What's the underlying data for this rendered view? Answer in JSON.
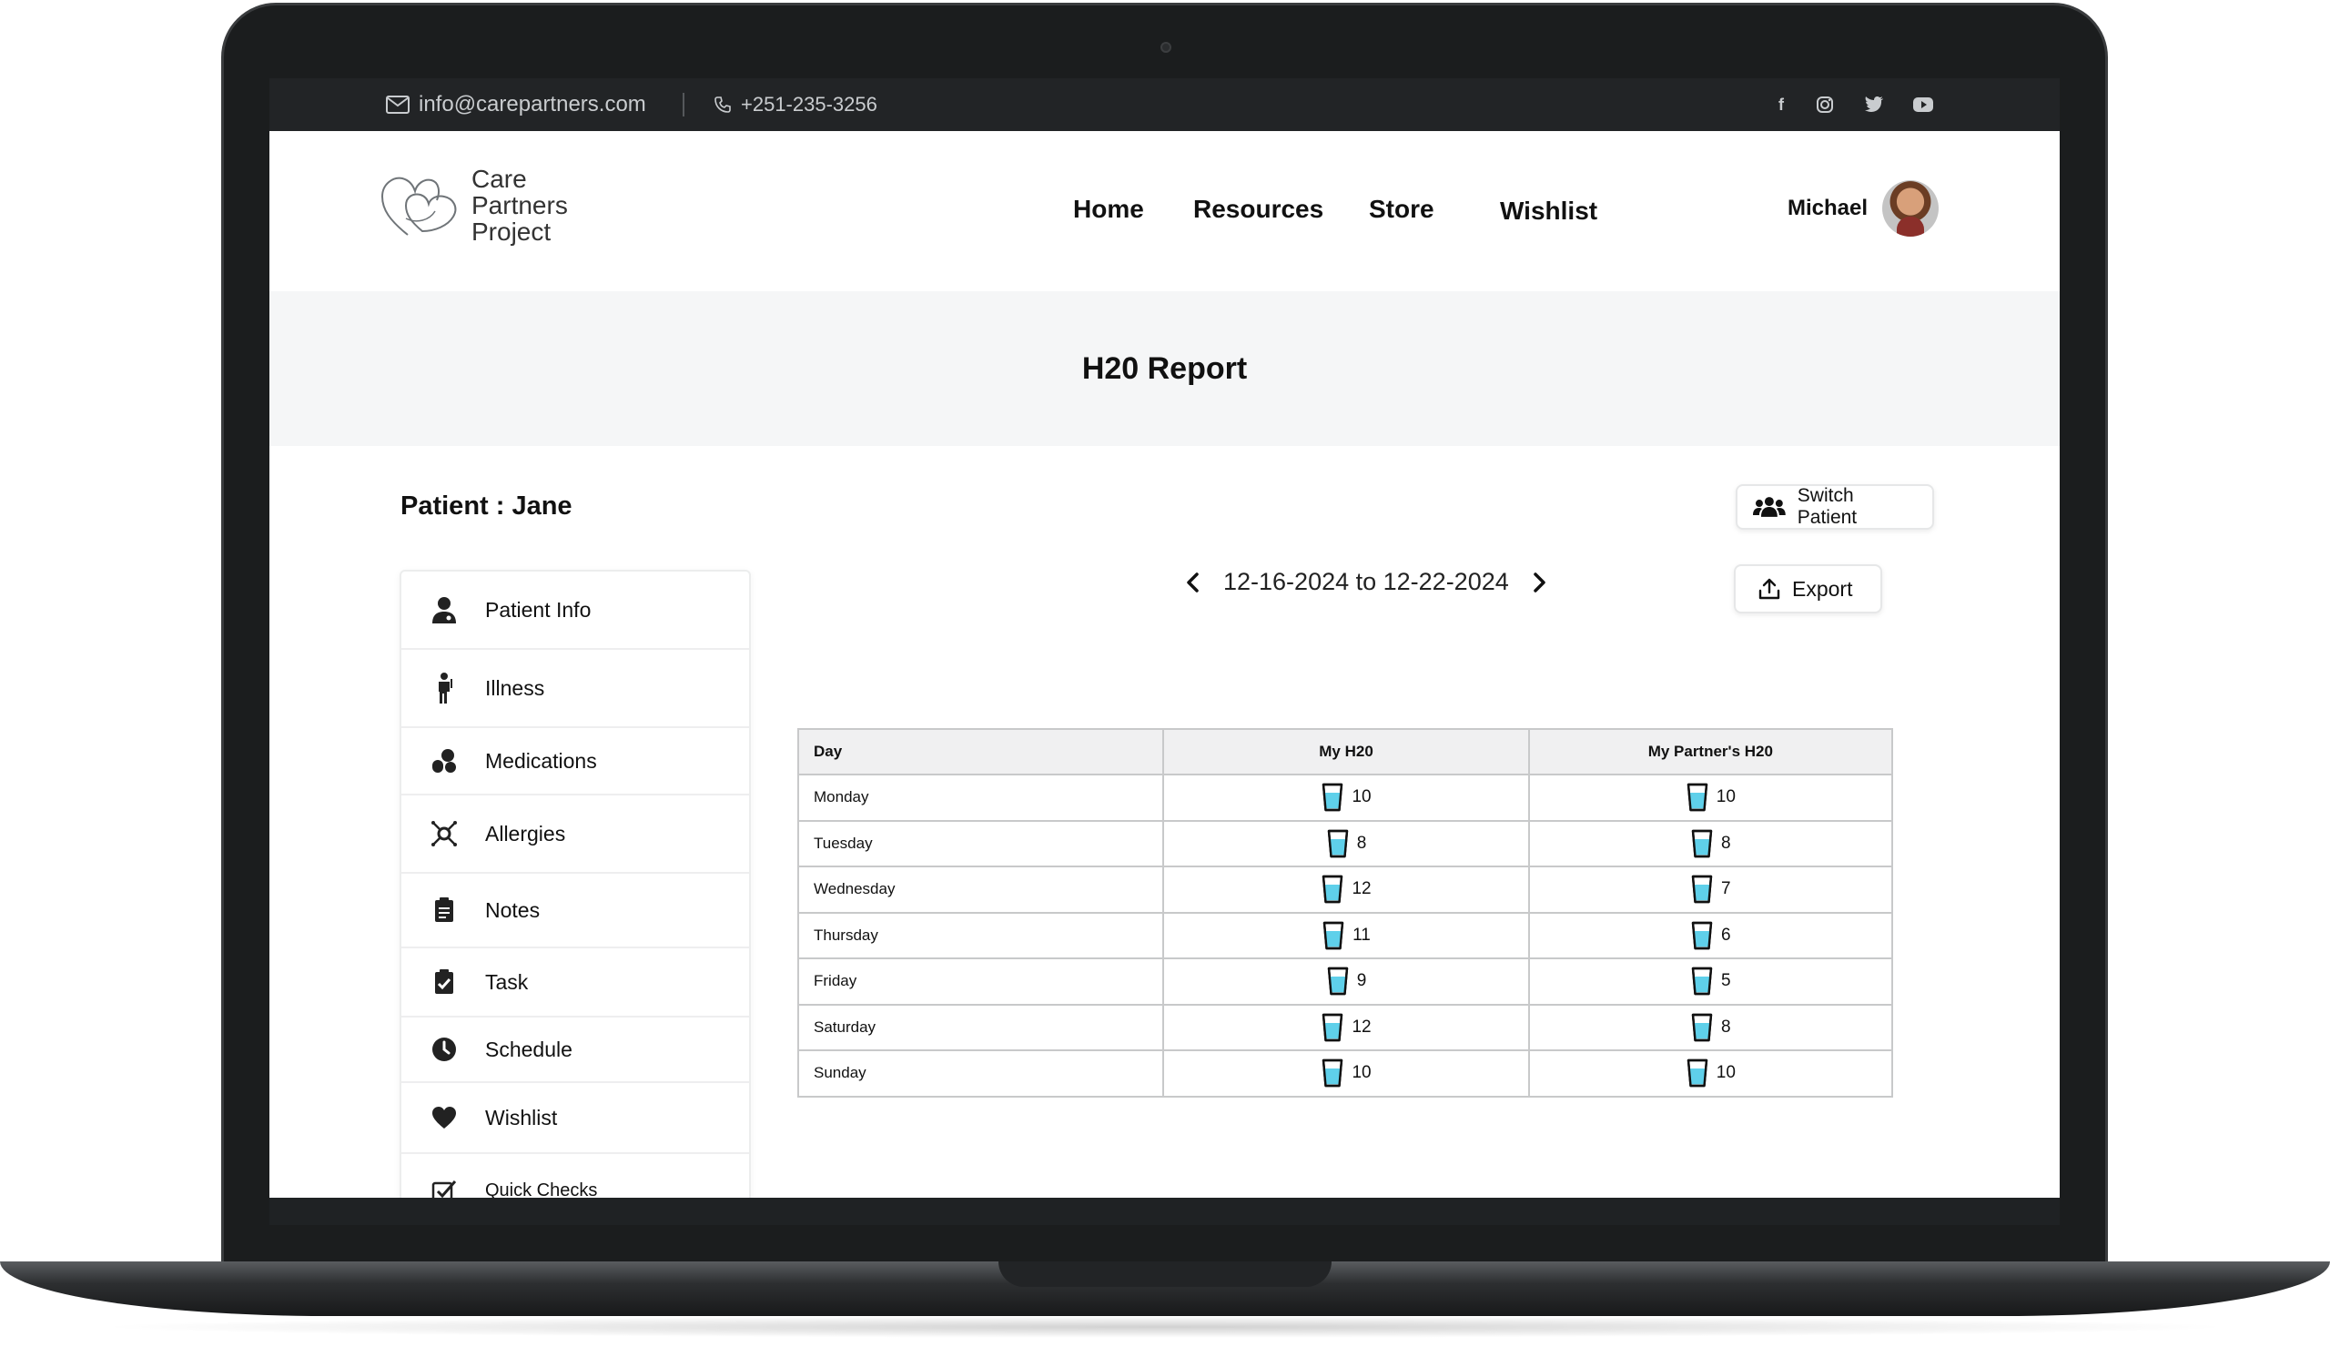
{
  "topbar": {
    "email": "info@carepartners.com",
    "phone": "+251-235-3256",
    "socials": [
      "facebook-icon",
      "instagram-icon",
      "twitter-icon",
      "youtube-icon"
    ]
  },
  "logo": {
    "line1": "Care",
    "line2": "Partners",
    "line3": "Project"
  },
  "nav": {
    "home": "Home",
    "resources": "Resources",
    "store": "Store",
    "wishlist": "Wishlist"
  },
  "user": {
    "name": "Michael"
  },
  "page": {
    "title": "H20 Report"
  },
  "patient": {
    "label": "Patient : Jane"
  },
  "buttons": {
    "switch_patient": "Switch Patient",
    "export": "Export"
  },
  "date_range": {
    "label": "12-16-2024 to 12-22-2024"
  },
  "sidebar": {
    "items": [
      {
        "label": "Patient Info",
        "icon": "user-doctor-icon"
      },
      {
        "label": "Illness",
        "icon": "person-ill-icon"
      },
      {
        "label": "Medications",
        "icon": "pills-icon"
      },
      {
        "label": "Allergies",
        "icon": "virus-icon"
      },
      {
        "label": "Notes",
        "icon": "notes-icon"
      },
      {
        "label": "Task",
        "icon": "clipboard-check-icon"
      },
      {
        "label": "Schedule",
        "icon": "clock-icon"
      },
      {
        "label": "Wishlist",
        "icon": "heart-icon"
      },
      {
        "label": "Quick Checks",
        "icon": "checkbox-icon"
      }
    ]
  },
  "table": {
    "headers": {
      "day": "Day",
      "mine": "My H20",
      "partner": "My Partner's H20"
    },
    "rows": [
      {
        "day": "Monday",
        "mine": "10",
        "partner": "10"
      },
      {
        "day": "Tuesday",
        "mine": "8",
        "partner": "8"
      },
      {
        "day": "Wednesday",
        "mine": "12",
        "partner": "7"
      },
      {
        "day": "Thursday",
        "mine": "11",
        "partner": "6"
      },
      {
        "day": "Friday",
        "mine": "9",
        "partner": "5"
      },
      {
        "day": "Saturday",
        "mine": "12",
        "partner": "8"
      },
      {
        "day": "Sunday",
        "mine": "10",
        "partner": "10"
      }
    ]
  },
  "colors": {
    "water": "#5fd0ea",
    "topbar": "#222426",
    "band": "#f5f6f7"
  }
}
